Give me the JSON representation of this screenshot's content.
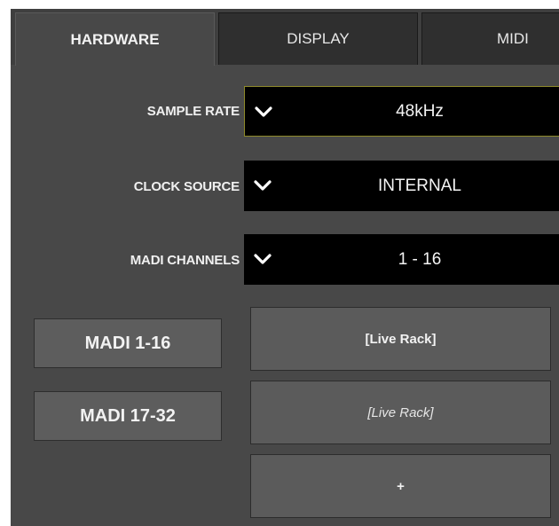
{
  "tabs": [
    {
      "label": "HARDWARE",
      "active": true
    },
    {
      "label": "DISPLAY",
      "active": false
    },
    {
      "label": "MIDI",
      "active": false
    }
  ],
  "settings": {
    "sample_rate": {
      "label": "SAMPLE RATE",
      "value": "48kHz"
    },
    "clock_source": {
      "label": "CLOCK SOURCE",
      "value": "INTERNAL"
    },
    "madi_channels": {
      "label": "MADI CHANNELS",
      "value": "1 - 16"
    }
  },
  "madi_buttons": [
    {
      "label": "MADI 1-16"
    },
    {
      "label": "MADI 17-32"
    }
  ],
  "slots": [
    {
      "label": "[Live Rack]"
    },
    {
      "label": "[Live Rack]"
    },
    {
      "label": "+"
    }
  ],
  "colors": {
    "panel": "#484848",
    "select_bg": "#000000",
    "focus_border": "#8e8a2a",
    "button_bg": "#5d5d5d"
  },
  "icons": {
    "dropdown": "chevron-down-icon"
  }
}
